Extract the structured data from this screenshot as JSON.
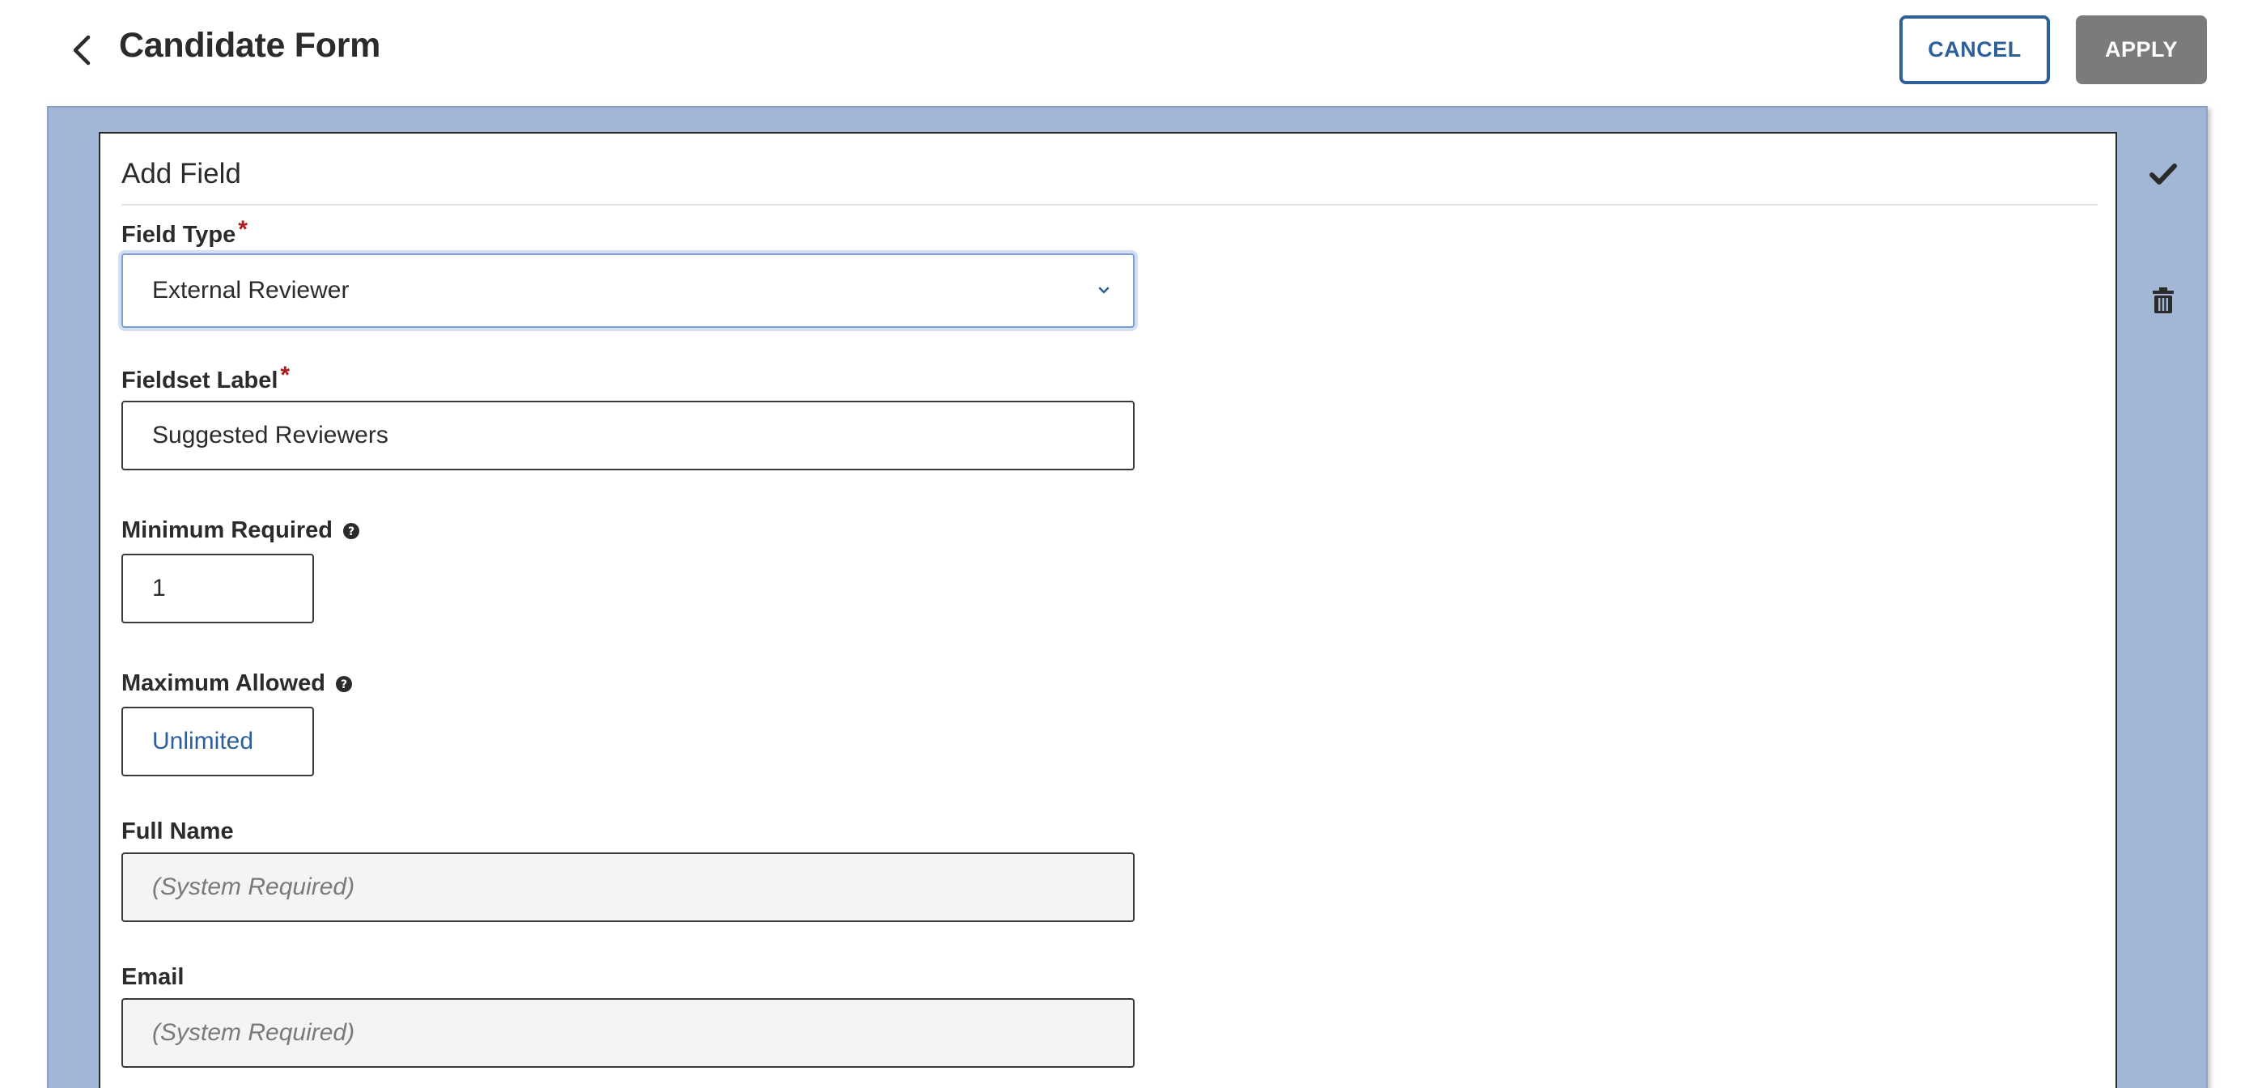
{
  "header": {
    "title": "Candidate Form",
    "cancel_label": "CANCEL",
    "apply_label": "APPLY",
    "apply_color": "#7b7b7b",
    "accent_color": "#2d5f9a"
  },
  "card": {
    "title": "Add Field",
    "panel_color": "#a2b6d6",
    "required_marker": "*"
  },
  "fields": {
    "field_type": {
      "label": "Field Type",
      "value": "External Reviewer"
    },
    "fieldset_label": {
      "label": "Fieldset Label",
      "value": "Suggested Reviewers"
    },
    "minimum_required": {
      "label": "Minimum Required",
      "value": "1"
    },
    "maximum_allowed": {
      "label": "Maximum Allowed",
      "value": "Unlimited"
    },
    "full_name": {
      "label": "Full Name",
      "value": "(System Required)"
    },
    "email": {
      "label": "Email",
      "value": "(System Required)"
    }
  },
  "icons": {
    "back": "chevron-left-icon",
    "confirm": "check-icon",
    "delete": "trash-icon",
    "help": "question-circle-icon",
    "dropdown": "chevron-down-icon"
  }
}
